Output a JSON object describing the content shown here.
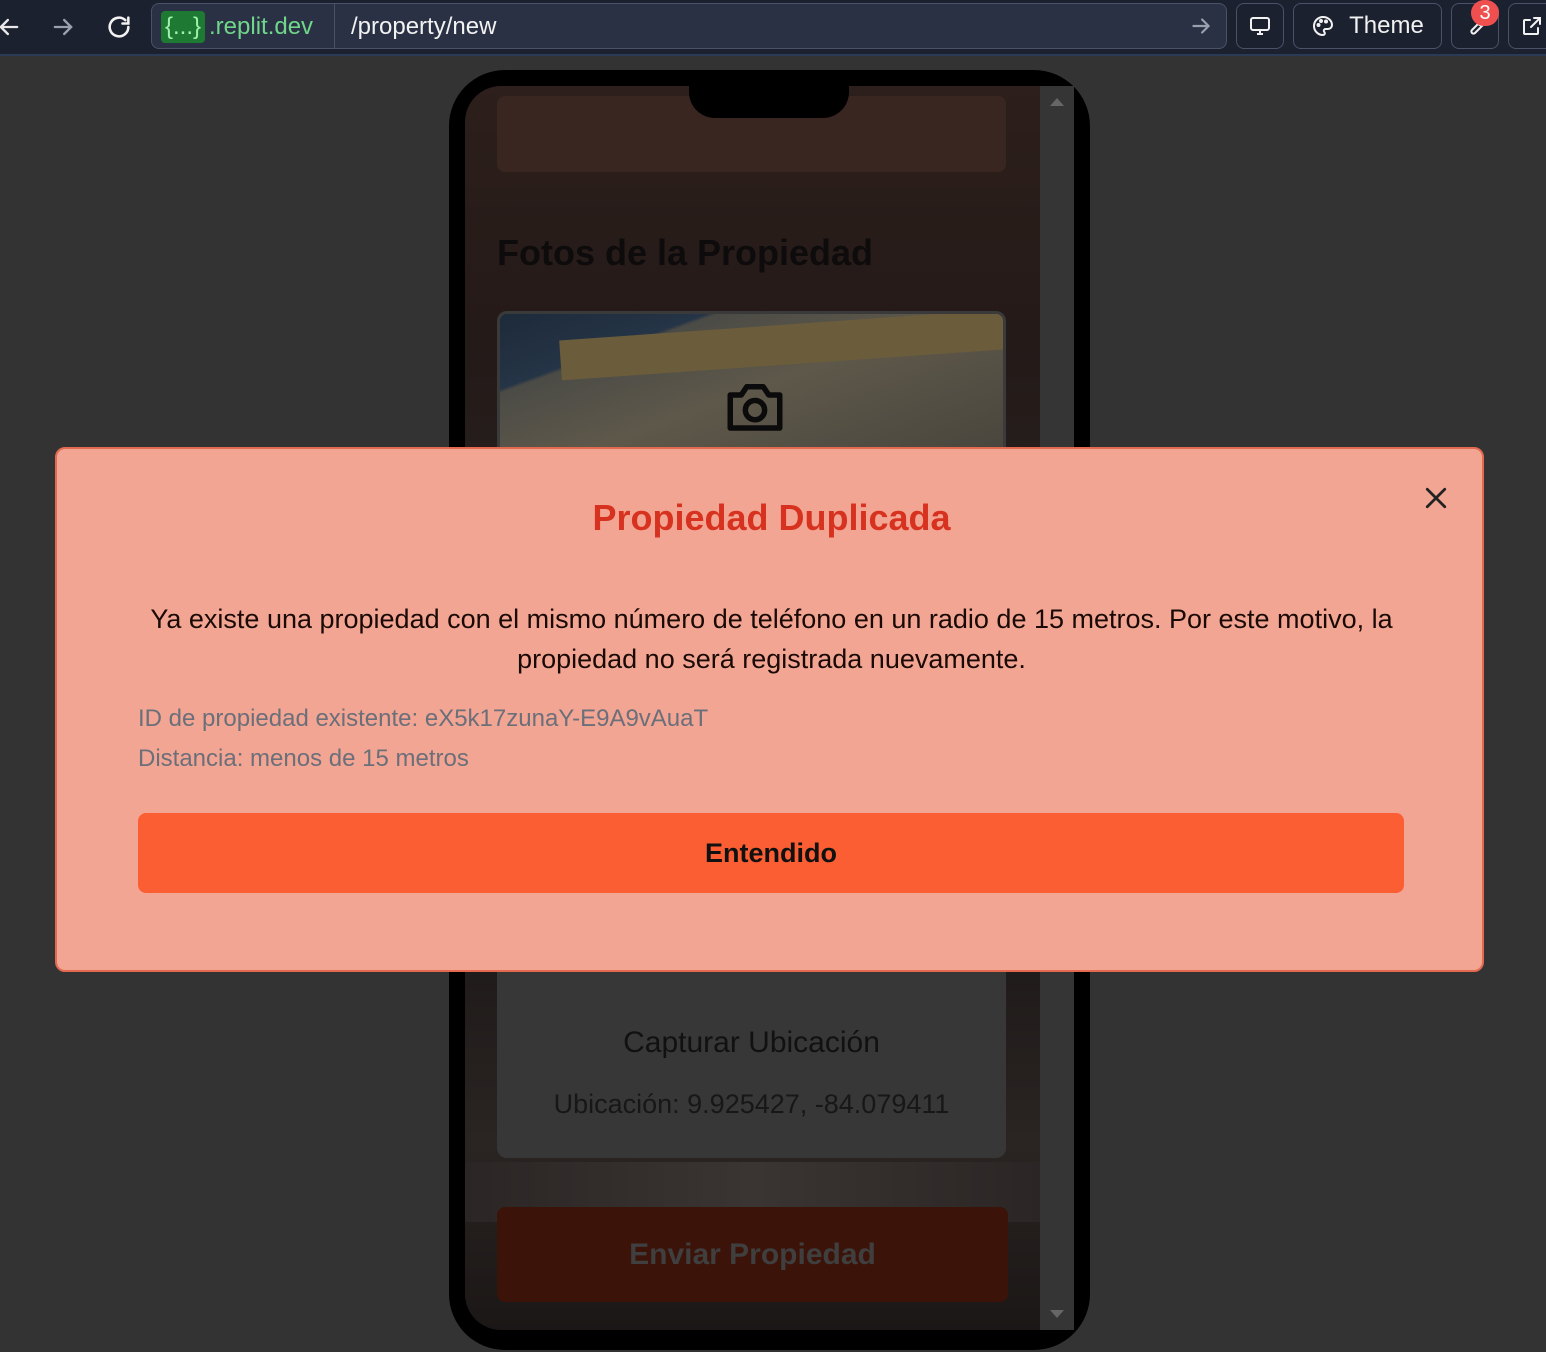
{
  "browser": {
    "host_badge": "{...}",
    "host": ".replit.dev",
    "path": "/property/new",
    "theme_label": "Theme",
    "devtools_badge": "3",
    "icons": [
      "back-icon",
      "forward-icon",
      "reload-icon",
      "go-arrow-icon",
      "monitor-icon",
      "palette-icon",
      "wrench-icon",
      "external-link-icon"
    ]
  },
  "app": {
    "photos_title": "Fotos de la Propiedad",
    "capture_location": "Capturar Ubicación",
    "location_text": "Ubicación: 9.925427, -84.079411",
    "submit_label": "Enviar Propiedad"
  },
  "modal": {
    "title": "Propiedad Duplicada",
    "message": "Ya existe una propiedad con el mismo número de teléfono en un radio de 15 metros. Por este motivo, la propiedad no será registrada nuevamente.",
    "existing_id": "ID de propiedad existente: eX5k17zunaY-E9A9vAuaT",
    "distance": "Distancia: menos de 15 metros",
    "confirm_label": "Entendido"
  },
  "colors": {
    "modal_bg": "#f3a593",
    "modal_title": "#d7321f",
    "confirm_button": "#fc5e33",
    "url_host": "#6fd68a"
  }
}
